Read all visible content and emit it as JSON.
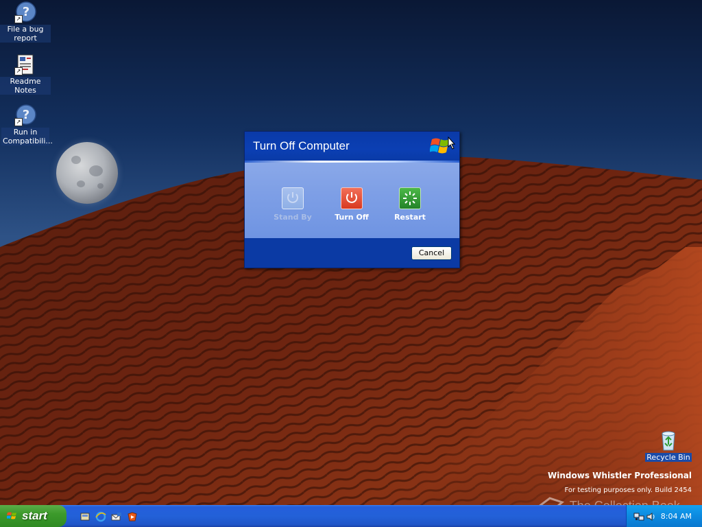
{
  "desktop": {
    "icons": [
      {
        "label": "File a bug report",
        "icon": "help-question-icon"
      },
      {
        "label": "Readme Notes",
        "icon": "document-icon"
      },
      {
        "label": "Run in Compatibili...",
        "icon": "help-question-icon"
      },
      {
        "label": "Recycle Bin",
        "icon": "recycle-bin-icon"
      }
    ],
    "branding": {
      "title": "Windows Whistler Professional",
      "subtitle": "For testing purposes only. Build 2454"
    },
    "watermark": "The Collection Book"
  },
  "dialog": {
    "title": "Turn Off Computer",
    "options": [
      {
        "label": "Stand By",
        "icon": "standby-icon",
        "enabled": false,
        "color": "#8fb0e6"
      },
      {
        "label": "Turn Off",
        "icon": "power-icon",
        "enabled": true,
        "color": "#e3402a"
      },
      {
        "label": "Restart",
        "icon": "restart-icon",
        "enabled": true,
        "color": "#2f9a2f"
      }
    ],
    "cancel_label": "Cancel"
  },
  "taskbar": {
    "start_label": "start",
    "quick_launch": [
      "show-desktop-icon",
      "internet-explorer-icon",
      "outlook-express-icon",
      "media-player-icon"
    ],
    "clock": "8:04 AM",
    "tray_icons": [
      "network-icon",
      "speaker-icon"
    ]
  },
  "colors": {
    "dialog_blue": "#0b3aa4",
    "taskbar_blue": "#245edb",
    "start_green": "#3c9a2b"
  }
}
